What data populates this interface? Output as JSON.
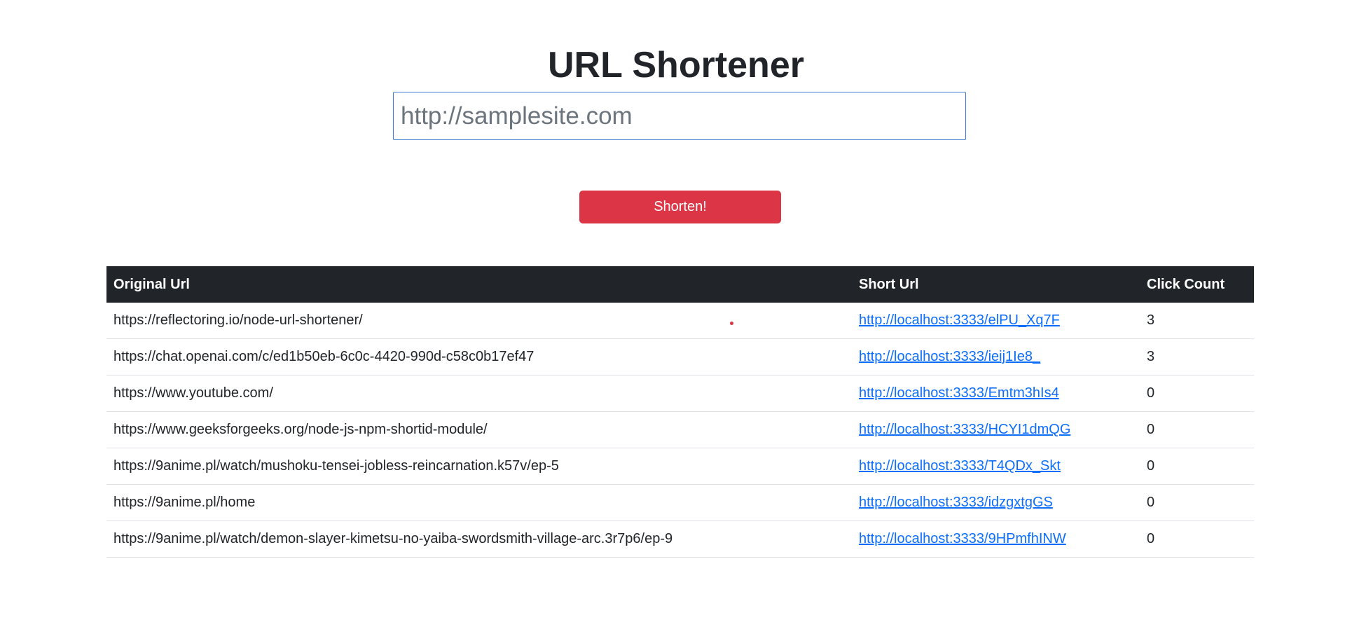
{
  "page": {
    "title": "URL Shortener"
  },
  "form": {
    "url_placeholder": "http://samplesite.com",
    "url_value": "",
    "submit_label": "Shorten!"
  },
  "table": {
    "headers": {
      "original": "Original Url",
      "short": "Short Url",
      "clicks": "Click Count"
    },
    "rows": [
      {
        "original": "https://reflectoring.io/node-url-shortener/",
        "short": "http://localhost:3333/elPU_Xq7F",
        "clicks": "3"
      },
      {
        "original": "https://chat.openai.com/c/ed1b50eb-6c0c-4420-990d-c58c0b17ef47",
        "short": "http://localhost:3333/ieij1Ie8_",
        "clicks": "3"
      },
      {
        "original": "https://www.youtube.com/",
        "short": "http://localhost:3333/Emtm3hIs4",
        "clicks": "0"
      },
      {
        "original": "https://www.geeksforgeeks.org/node-js-npm-shortid-module/",
        "short": "http://localhost:3333/HCYI1dmQG",
        "clicks": "0"
      },
      {
        "original": "https://9anime.pl/watch/mushoku-tensei-jobless-reincarnation.k57v/ep-5",
        "short": "http://localhost:3333/T4QDx_Skt",
        "clicks": "0"
      },
      {
        "original": "https://9anime.pl/home",
        "short": "http://localhost:3333/idzgxtgGS",
        "clicks": "0"
      },
      {
        "original": "https://9anime.pl/watch/demon-slayer-kimetsu-no-yaiba-swordsmith-village-arc.3r7p6/ep-9",
        "short": "http://localhost:3333/9HPmfhINW",
        "clicks": "0"
      }
    ]
  },
  "colors": {
    "primary_button": "#dc3545",
    "table_header_bg": "#212529",
    "link": "#0d6efd",
    "input_border": "#3b7fd4"
  }
}
